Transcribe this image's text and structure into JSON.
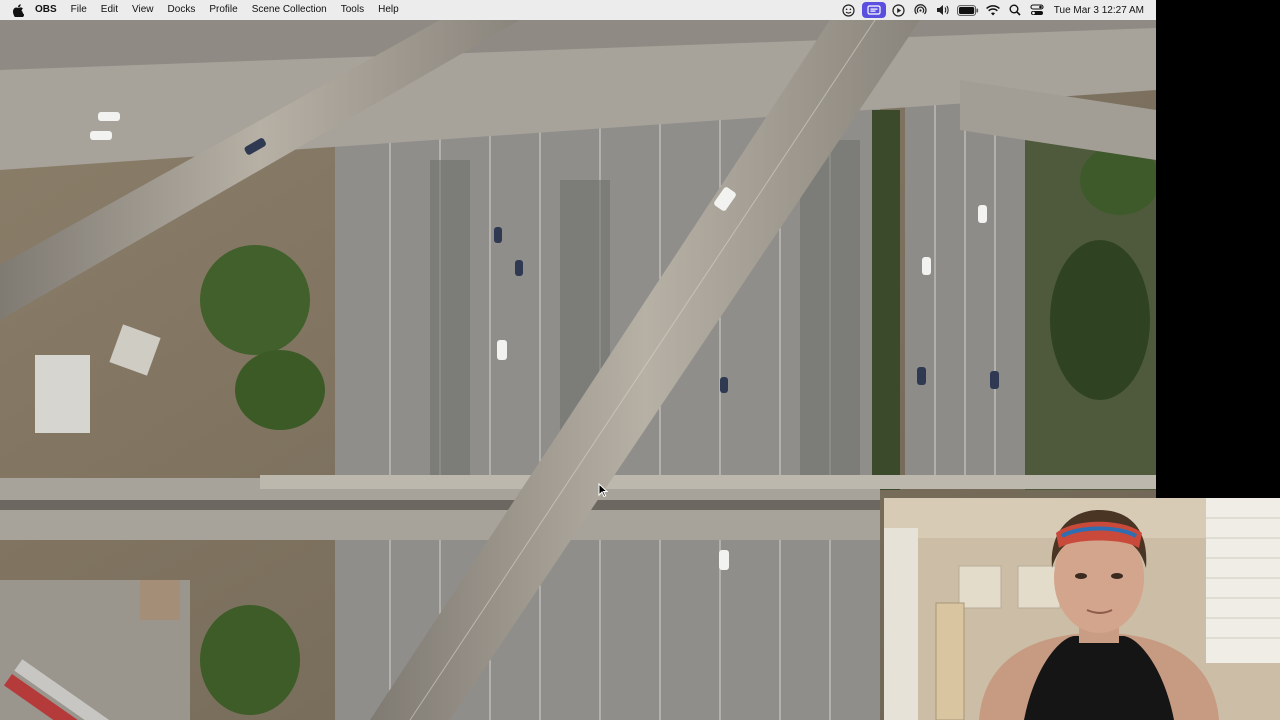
{
  "menubar": {
    "app_name": "OBS",
    "items": [
      "File",
      "Edit",
      "View",
      "Docks",
      "Profile",
      "Scene Collection",
      "Tools",
      "Help"
    ],
    "status_icons": [
      "smiley-icon",
      "screen-mirror-icon",
      "play-icon",
      "airdrop-icon",
      "volume-icon",
      "battery-icon",
      "wifi-icon",
      "search-icon",
      "control-center-icon"
    ],
    "clock": "Tue Mar 3  12:27 AM"
  },
  "colors": {
    "menubar_bg": "#ececec",
    "active_icon_bg": "#5b4fe0",
    "road": "#9a9a95",
    "bridge": "#b9b4aa",
    "vegetation": "#3f5a2a"
  }
}
